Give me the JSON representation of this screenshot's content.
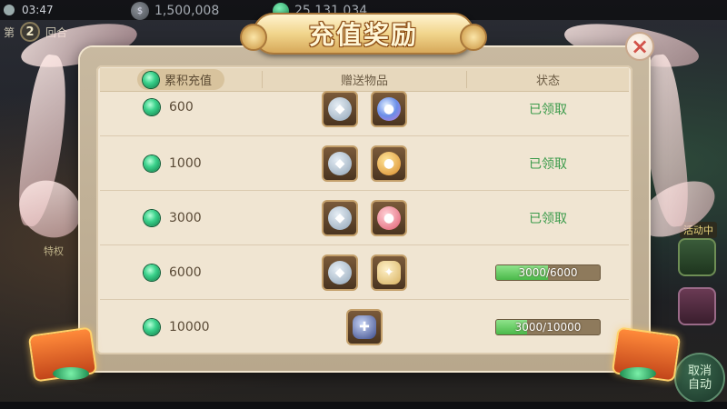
{
  "status_bar": {
    "time": "03:47"
  },
  "currency": {
    "silver": "1,500,008",
    "gold": "25,131,034"
  },
  "round": {
    "prefix": "第",
    "number": "2",
    "suffix": "回合"
  },
  "dialog": {
    "title": "充值奖励",
    "close_symbol": "×",
    "header": {
      "cumulative": "累积充值",
      "items": "赠送物品",
      "status": "状态"
    },
    "rows": [
      {
        "amount": "600",
        "items": [
          "gift-pack-icon",
          "crystal-orb-icon"
        ],
        "status_text": "已领取",
        "claimed": true
      },
      {
        "amount": "1000",
        "items": [
          "gift-pack-icon",
          "gold-pouch-icon"
        ],
        "status_text": "已领取",
        "claimed": true
      },
      {
        "amount": "3000",
        "items": [
          "gift-pack-icon",
          "pink-pouch-icon"
        ],
        "status_text": "已领取",
        "claimed": true
      },
      {
        "amount": "6000",
        "items": [
          "gift-pack-icon",
          "dragon-mount-icon"
        ],
        "status_text": "3000/6000",
        "claimed": false,
        "progress": 0.5
      },
      {
        "amount": "10000",
        "items": [
          "weapon-icon"
        ],
        "status_text": "3000/10000",
        "claimed": false,
        "progress": 0.3
      }
    ]
  },
  "side": {
    "left_label": "特权",
    "right_label": "活动中"
  },
  "auto_button": {
    "line1": "取消",
    "line2": "自动"
  },
  "colors": {
    "accent_green": "#3a9a4a",
    "progress_fill": "#4ab94a",
    "close_red": "#d2534a"
  }
}
